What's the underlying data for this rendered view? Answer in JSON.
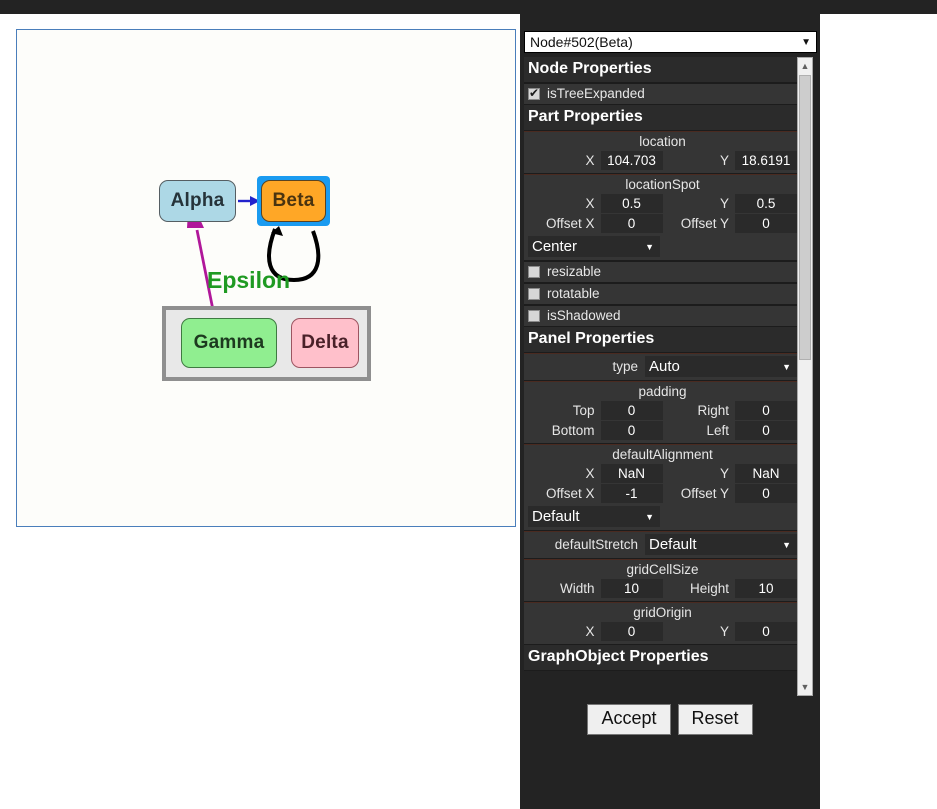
{
  "topbar": {
    "present": true,
    "color": "#232323"
  },
  "diagram": {
    "nodes": [
      {
        "key": "alpha",
        "label": "Alpha",
        "fill": "#add8e6",
        "selected": false
      },
      {
        "key": "beta",
        "label": "Beta",
        "fill": "#ffa726",
        "selected": true
      },
      {
        "key": "gamma",
        "label": "Gamma",
        "fill": "#90ee90",
        "selected": false
      },
      {
        "key": "delta",
        "label": "Delta",
        "fill": "#ffc0cb",
        "selected": false
      }
    ],
    "group_label": "Epsilon",
    "group_label_color": "#1f9a22",
    "links": [
      {
        "from": "alpha",
        "to": "beta",
        "color": "#2222cc"
      },
      {
        "from": "beta",
        "to": "beta",
        "color": "#000000"
      },
      {
        "from": "gamma",
        "to": "delta",
        "color": "#1f9a22"
      },
      {
        "from": "epsilon",
        "to": "alpha",
        "color": "#b0179a"
      }
    ],
    "selection_color": "#1a9bf0",
    "border_color": "#4a7ebb"
  },
  "inspector": {
    "selector": {
      "value": "Node#502(Beta)",
      "caret": "▼"
    },
    "sections": [
      {
        "title": "Node Properties",
        "rows": [
          {
            "kind": "checkbox",
            "label": "isTreeExpanded",
            "checked": true
          }
        ]
      },
      {
        "title": "Part Properties",
        "rows": [
          {
            "kind": "xy",
            "caption": "location",
            "x_label": "X",
            "x_value": "104.703",
            "y_label": "Y",
            "y_value": "18.6191"
          },
          {
            "kind": "spot",
            "caption": "locationSpot",
            "x_label": "X",
            "x_value": "0.5",
            "y_label": "Y",
            "y_value": "0.5",
            "ox_label": "Offset X",
            "ox_value": "0",
            "oy_label": "Offset Y",
            "oy_value": "0",
            "select_value": "Center",
            "caret": "▼"
          },
          {
            "kind": "checkbox",
            "label": "resizable",
            "checked": false
          },
          {
            "kind": "checkbox",
            "label": "rotatable",
            "checked": false
          },
          {
            "kind": "checkbox",
            "label": "isShadowed",
            "checked": false
          }
        ]
      },
      {
        "title": "Panel Properties",
        "rows": [
          {
            "kind": "inline-select",
            "label": "type",
            "value": "Auto",
            "caret": "▼"
          },
          {
            "kind": "quad",
            "caption": "padding",
            "a_label": "Top",
            "a_value": "0",
            "b_label": "Right",
            "b_value": "0",
            "c_label": "Bottom",
            "c_value": "0",
            "d_label": "Left",
            "d_value": "0"
          },
          {
            "kind": "spot",
            "caption": "defaultAlignment",
            "x_label": "X",
            "x_value": "NaN",
            "y_label": "Y",
            "y_value": "NaN",
            "ox_label": "Offset X",
            "ox_value": "-1",
            "oy_label": "Offset Y",
            "oy_value": "0",
            "select_value": "Default",
            "caret": "▼"
          },
          {
            "kind": "inline-select",
            "label": "defaultStretch",
            "value": "Default",
            "caret": "▼"
          },
          {
            "kind": "xy",
            "caption": "gridCellSize",
            "x_label": "Width",
            "x_value": "10",
            "y_label": "Height",
            "y_value": "10"
          },
          {
            "kind": "xy",
            "caption": "gridOrigin",
            "x_label": "X",
            "x_value": "0",
            "y_label": "Y",
            "y_value": "0"
          }
        ]
      },
      {
        "title": "GraphObject Properties",
        "clipped": true,
        "rows": []
      }
    ],
    "scrollbar": {
      "up": "▲",
      "down": "▼"
    },
    "buttons": {
      "accept": "Accept",
      "reset": "Reset"
    }
  }
}
